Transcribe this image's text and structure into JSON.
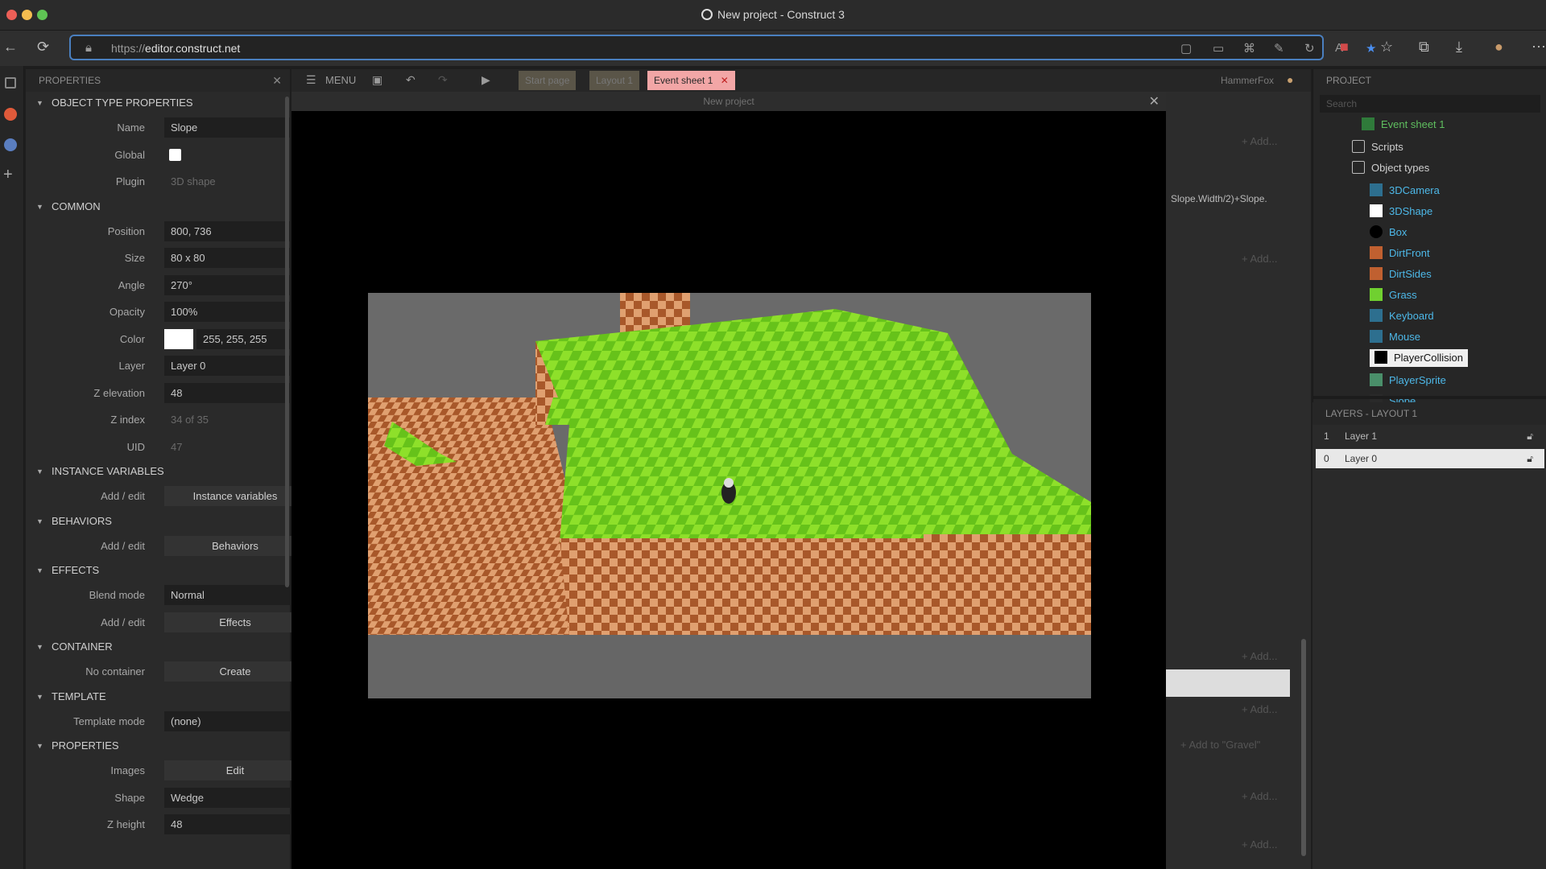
{
  "window": {
    "title": "New project - Construct 3"
  },
  "browser": {
    "url_proto": "https://",
    "url_host": "editor.construct.net"
  },
  "properties_panel": {
    "header": "PROPERTIES",
    "sections": {
      "object_type": "OBJECT TYPE PROPERTIES",
      "common": "COMMON",
      "instance_vars": "INSTANCE VARIABLES",
      "behaviors": "BEHAVIORS",
      "effects": "EFFECTS",
      "container": "CONTAINER",
      "template": "TEMPLATE",
      "properties": "PROPERTIES"
    },
    "name": {
      "label": "Name",
      "value": "Slope"
    },
    "global": {
      "label": "Global"
    },
    "plugin": {
      "label": "Plugin",
      "value": "3D shape"
    },
    "position": {
      "label": "Position",
      "value": "800, 736"
    },
    "size": {
      "label": "Size",
      "value": "80 x 80"
    },
    "angle": {
      "label": "Angle",
      "value": "270°"
    },
    "opacity": {
      "label": "Opacity",
      "value": "100%"
    },
    "color": {
      "label": "Color",
      "value": "255, 255, 255",
      "swatch": "#ffffff"
    },
    "layer": {
      "label": "Layer",
      "value": "Layer 0"
    },
    "z_elevation": {
      "label": "Z elevation",
      "value": "48"
    },
    "z_index": {
      "label": "Z index",
      "value": "34 of 35"
    },
    "uid": {
      "label": "UID",
      "value": "47"
    },
    "instance_vars": {
      "label": "Add / edit",
      "button": "Instance variables"
    },
    "behaviors": {
      "label": "Add / edit",
      "button": "Behaviors"
    },
    "blend_mode": {
      "label": "Blend mode",
      "value": "Normal"
    },
    "effects": {
      "label": "Add / edit",
      "button": "Effects"
    },
    "container": {
      "label": "No container",
      "button": "Create"
    },
    "template_mode": {
      "label": "Template mode",
      "value": "(none)"
    },
    "images": {
      "label": "Images",
      "button": "Edit"
    },
    "shape": {
      "label": "Shape",
      "value": "Wedge"
    },
    "z_height": {
      "label": "Z height",
      "value": "48"
    }
  },
  "toolbar": {
    "menu": "MENU",
    "tabs": [
      "Start page",
      "Layout 1",
      "Event sheet 1"
    ],
    "user": "HammerFox"
  },
  "dialog": {
    "title": "New project"
  },
  "event_sheet": {
    "add": "+ Add...",
    "expr": "Slope.Width/2)+Slope.",
    "add_to": "+ Add to \"Gravel\""
  },
  "project_panel": {
    "header": "PROJECT",
    "search_placeholder": "Search",
    "items": [
      {
        "label": "Event sheet 1",
        "color": "#5fbf5f"
      },
      {
        "label": "Scripts",
        "color": "#cfcfcf"
      },
      {
        "label": "Object types",
        "color": "#cfcfcf"
      },
      {
        "label": "3DCamera",
        "color": "#4db8e8"
      },
      {
        "label": "3DShape",
        "color": "#4db8e8"
      },
      {
        "label": "Box",
        "color": "#4db8e8"
      },
      {
        "label": "DirtFront",
        "color": "#4db8e8"
      },
      {
        "label": "DirtSides",
        "color": "#4db8e8"
      },
      {
        "label": "Grass",
        "color": "#4db8e8"
      },
      {
        "label": "Keyboard",
        "color": "#4db8e8"
      },
      {
        "label": "Mouse",
        "color": "#4db8e8"
      },
      {
        "label": "PlayerCollision",
        "color": "#111111"
      },
      {
        "label": "PlayerSprite",
        "color": "#4db8e8"
      },
      {
        "label": "Slope",
        "color": "#4db8e8"
      }
    ]
  },
  "layers_panel": {
    "header": "LAYERS - LAYOUT 1",
    "layers": [
      {
        "index": "1",
        "name": "Layer 1"
      },
      {
        "index": "0",
        "name": "Layer 0"
      }
    ]
  }
}
